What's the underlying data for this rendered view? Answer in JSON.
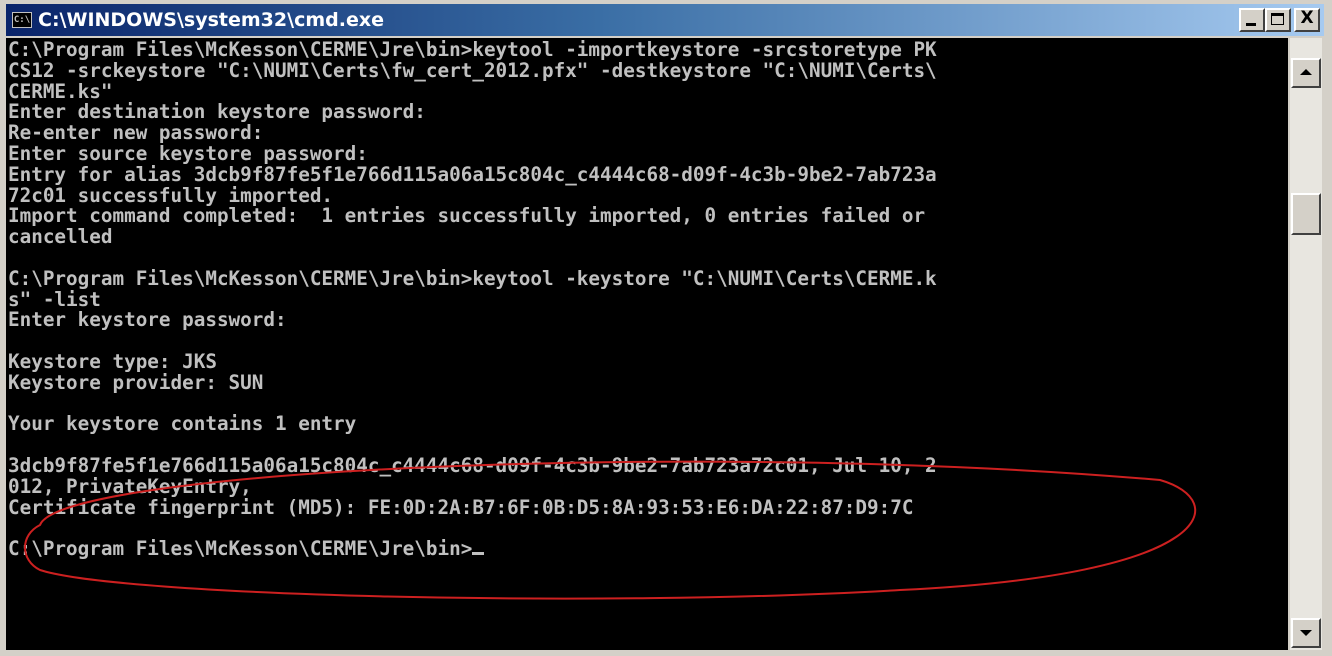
{
  "window": {
    "title": "C:\\WINDOWS\\system32\\cmd.exe",
    "icon": "cmd-icon",
    "buttons": [
      "minimize-icon",
      "maximize-icon",
      "close-icon"
    ],
    "close_glyph": "X"
  },
  "console": {
    "lines": [
      "C:\\Program Files\\McKesson\\CERME\\Jre\\bin>keytool -importkeystore -srcstoretype PK",
      "CS12 -srckeystore \"C:\\NUMI\\Certs\\fw_cert_2012.pfx\" -destkeystore \"C:\\NUMI\\Certs\\",
      "CERME.ks\"",
      "Enter destination keystore password:",
      "Re-enter new password:",
      "Enter source keystore password:",
      "Entry for alias 3dcb9f87fe5f1e766d115a06a15c804c_c4444c68-d09f-4c3b-9be2-7ab723a",
      "72c01 successfully imported.",
      "Import command completed:  1 entries successfully imported, 0 entries failed or",
      "cancelled",
      "",
      "C:\\Program Files\\McKesson\\CERME\\Jre\\bin>keytool -keystore \"C:\\NUMI\\Certs\\CERME.k",
      "s\" -list",
      "Enter keystore password:",
      "",
      "Keystore type: JKS",
      "Keystore provider: SUN",
      "",
      "Your keystore contains 1 entry",
      "",
      "3dcb9f87fe5f1e766d115a06a15c804c_c4444c68-d09f-4c3b-9be2-7ab723a72c01, Jul 10, 2",
      "012, PrivateKeyEntry,",
      "Certificate fingerprint (MD5): FE:0D:2A:B7:6F:0B:D5:8A:93:53:E6:DA:22:87:D9:7C",
      "",
      "C:\\Program Files\\McKesson\\CERME\\Jre\\bin>"
    ]
  },
  "colors": {
    "console_bg": "#000000",
    "console_fg": "#c0c0c0",
    "titlebar_start": "#0a246a",
    "titlebar_end": "#a6caf0",
    "annotation": "#cc2020"
  }
}
